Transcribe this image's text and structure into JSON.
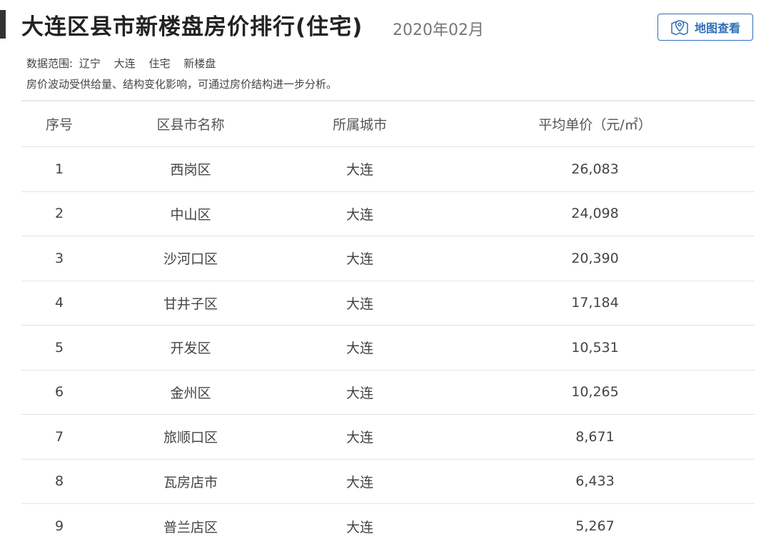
{
  "header": {
    "title": "大连区县市新楼盘房价排行(住宅)",
    "date": "2020年02月",
    "map_button_label": "地图查看"
  },
  "info": {
    "scope_label": "数据范围:",
    "scope_items": [
      "辽宁",
      "大连",
      "住宅",
      "新楼盘"
    ],
    "note": "房价波动受供给量、结构变化影响，可通过房价结构进一步分析。"
  },
  "table": {
    "columns": [
      "序号",
      "区县市名称",
      "所属城市",
      "平均单价（元/㎡）"
    ],
    "rows": [
      {
        "rank": "1",
        "district": "西岗区",
        "city": "大连",
        "price": "26,083"
      },
      {
        "rank": "2",
        "district": "中山区",
        "city": "大连",
        "price": "24,098"
      },
      {
        "rank": "3",
        "district": "沙河口区",
        "city": "大连",
        "price": "20,390"
      },
      {
        "rank": "4",
        "district": "甘井子区",
        "city": "大连",
        "price": "17,184"
      },
      {
        "rank": "5",
        "district": "开发区",
        "city": "大连",
        "price": "10,531"
      },
      {
        "rank": "6",
        "district": "金州区",
        "city": "大连",
        "price": "10,265"
      },
      {
        "rank": "7",
        "district": "旅顺口区",
        "city": "大连",
        "price": "8,671"
      },
      {
        "rank": "8",
        "district": "瓦房店市",
        "city": "大连",
        "price": "6,433"
      },
      {
        "rank": "9",
        "district": "普兰店区",
        "city": "大连",
        "price": "5,267"
      }
    ]
  },
  "colors": {
    "accent": "#2f6fb8",
    "title": "#222222",
    "divider": "#e3e3e3"
  }
}
